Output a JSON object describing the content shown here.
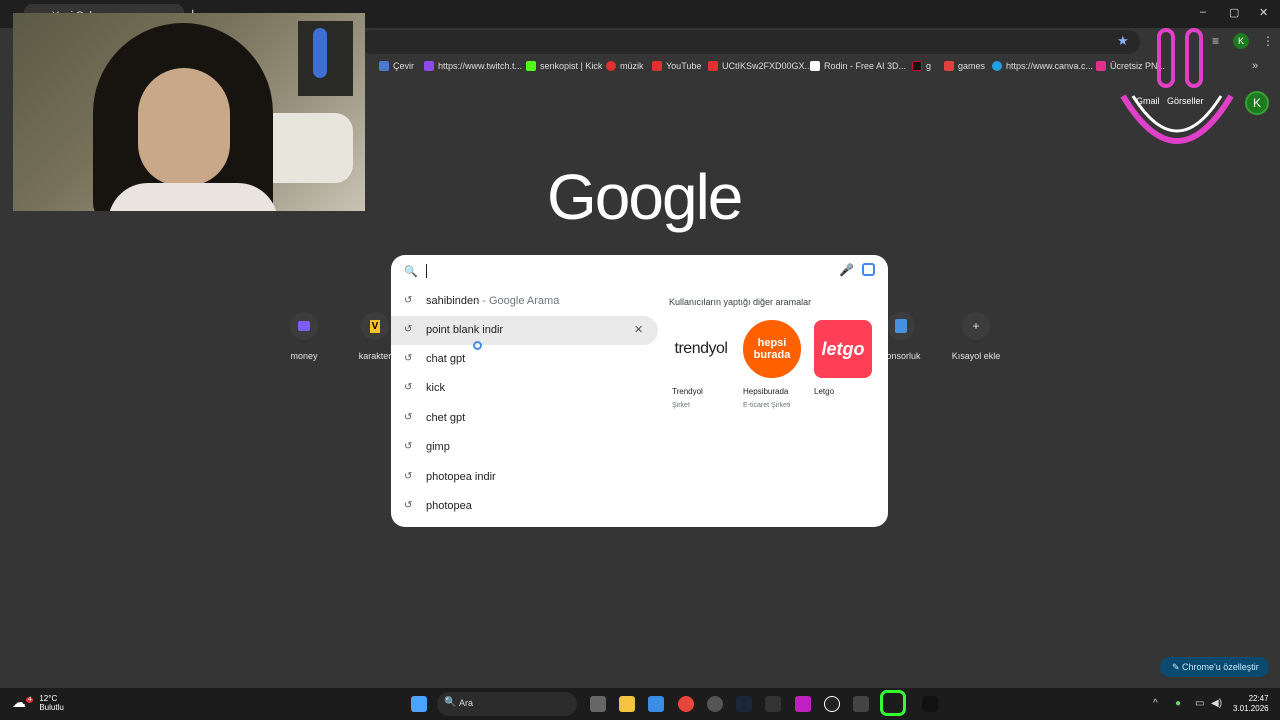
{
  "browser": {
    "tab_title": "Yeni Sekme",
    "new_tab_symbol": "+",
    "window_controls": [
      "–",
      "▢",
      "✕"
    ]
  },
  "bookmarks": [
    {
      "label": "Çevir",
      "color": "#4a7bd0"
    },
    {
      "label": "https://www.twitch.t...",
      "color": "#8a4be8"
    },
    {
      "label": "senkopist | Kick",
      "color": "#53fc18"
    },
    {
      "label": "müzik",
      "color": "#e03030"
    },
    {
      "label": "YouTube",
      "color": "#e03030"
    },
    {
      "label": "UCtIKSw2FXD00GX...",
      "color": "#e03030"
    },
    {
      "label": "Rodin - Free AI 3D...",
      "color": "#ffffff"
    },
    {
      "label": "g",
      "color": "#222222"
    },
    {
      "label": "games",
      "color": "#e04040"
    },
    {
      "label": "https://www.canva.c...",
      "color": "#20a0e0"
    },
    {
      "label": "Ücretsiz PN...",
      "color": "#e0308a"
    }
  ],
  "header": {
    "gmail": "Gmail",
    "images": "Görseller",
    "avatar_letter": "K"
  },
  "logo": "Google",
  "search": {
    "suggestions": [
      {
        "text": "sahibinden",
        "sub": " - Google Arama"
      },
      {
        "text": "point blank indir",
        "sub": ""
      },
      {
        "text": "chat gpt",
        "sub": ""
      },
      {
        "text": "kick",
        "sub": ""
      },
      {
        "text": "chet gpt",
        "sub": ""
      },
      {
        "text": "gimp",
        "sub": ""
      },
      {
        "text": "photopea indir",
        "sub": ""
      },
      {
        "text": "photopea",
        "sub": ""
      }
    ],
    "others_title": "Kullanıcıların yaptığı diğer aramalar",
    "cards": [
      {
        "name": "Trendyol",
        "sub": "Şirket",
        "logo": "trendyol"
      },
      {
        "name": "Hepsiburada",
        "sub": "E-ticaret Şirketi",
        "logo": "hepsi burada"
      },
      {
        "name": "Letgo",
        "sub": "",
        "logo": "letgo"
      }
    ]
  },
  "shortcuts": [
    {
      "label": "money"
    },
    {
      "label": "karakter"
    },
    {
      "label": "ponsorluk"
    },
    {
      "label": "Kısayol ekle"
    }
  ],
  "customize_label": "Chrome'u özelleştir",
  "taskbar": {
    "temp": "12°C",
    "condition": "Bulutlu",
    "weather_badge": "4",
    "search_placeholder": "Ara",
    "time": "22:47",
    "date": "3.01.2026"
  }
}
